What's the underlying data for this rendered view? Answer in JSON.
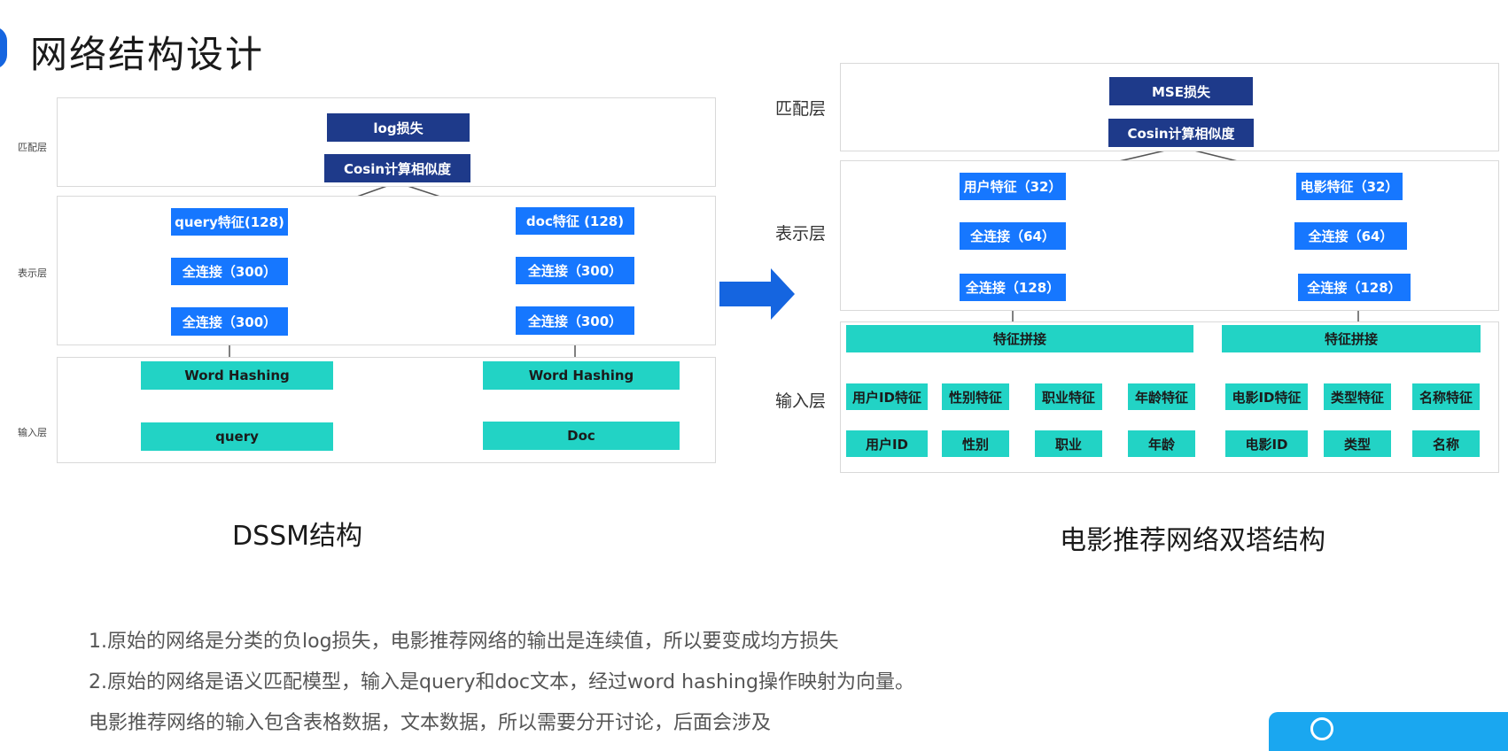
{
  "title": "网络结构设计",
  "dssm": {
    "layer_labels": {
      "match": "匹配层",
      "represent": "表示层",
      "input": "输入层"
    },
    "match_boxes": {
      "loss": "log损失",
      "cosine": "Cosin计算相似度"
    },
    "left_tower": {
      "feature": "query特征(128)",
      "fc1": "全连接（300）",
      "fc2": "全连接（300）",
      "hashing": "Word Hashing",
      "input": "query"
    },
    "right_tower": {
      "feature": "doc特征 (128)",
      "fc1": "全连接（300）",
      "fc2": "全连接（300）",
      "hashing": "Word Hashing",
      "input": "Doc"
    },
    "caption": "DSSM结构"
  },
  "arrow_color": "#1565e0",
  "movie": {
    "layer_labels": {
      "match": "匹配层",
      "represent": "表示层",
      "input": "输入层"
    },
    "match_boxes": {
      "loss": "MSE损失",
      "cosine": "Cosin计算相似度"
    },
    "user_tower": {
      "feature": "用户特征（32）",
      "fc1": "全连接（64）",
      "fc2": "全连接（128）",
      "concat": "特征拼接",
      "features": [
        "用户ID特征",
        "性别特征",
        "职业特征",
        "年龄特征"
      ],
      "inputs": [
        "用户ID",
        "性别",
        "职业",
        "年龄"
      ]
    },
    "movie_tower": {
      "feature": "电影特征（32）",
      "fc1": "全连接（64）",
      "fc2": "全连接（128）",
      "concat": "特征拼接",
      "features": [
        "电影ID特征",
        "类型特征",
        "名称特征"
      ],
      "inputs": [
        "电影ID",
        "类型",
        "名称"
      ]
    },
    "caption": "电影推荐网络双塔结构"
  },
  "notes": [
    "1.原始的网络是分类的负log损失，电影推荐网络的输出是连续值，所以要变成均方损失",
    "2.原始的网络是语义匹配模型，输入是query和doc文本，经过word hashing操作映射为向量。",
    "电影推荐网络的输入包含表格数据，文本数据，所以需要分开讨论，后面会涉及"
  ],
  "colors": {
    "navy": "#1e3a8a",
    "blue": "#1677ff",
    "teal": "#22d3c5"
  }
}
